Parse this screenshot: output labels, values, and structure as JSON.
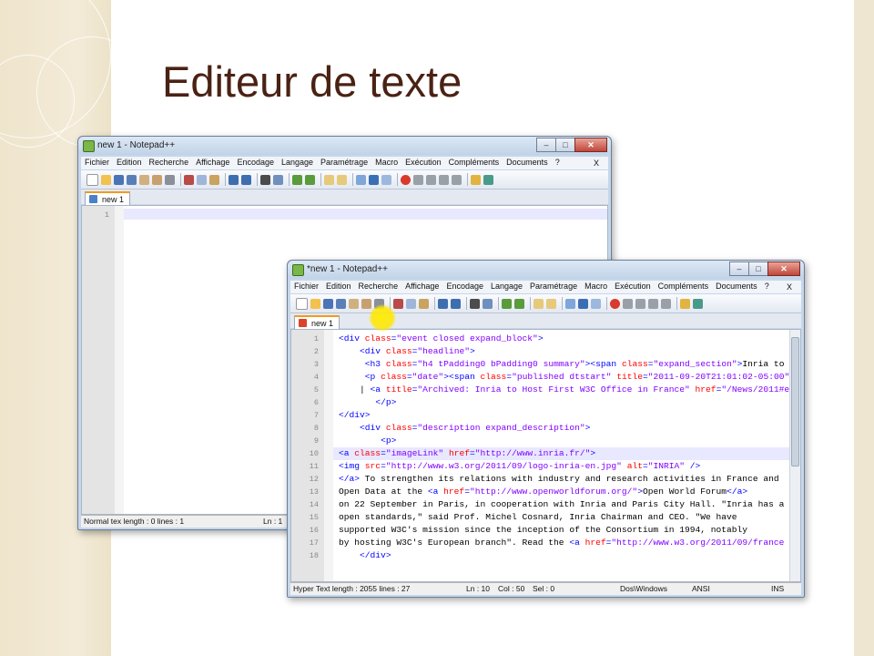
{
  "slide": {
    "title": "Editeur de texte"
  },
  "window_back": {
    "title": "new  1 - Notepad++",
    "menu": [
      "Fichier",
      "Edition",
      "Recherche",
      "Affichage",
      "Encodage",
      "Langage",
      "Paramétrage",
      "Macro",
      "Exécution",
      "Compléments",
      "Documents",
      "?"
    ],
    "menu_close": "X",
    "tab": "new  1",
    "line_numbers": [
      "1"
    ],
    "status": {
      "left": "Normal tex length : 0   lines : 1",
      "pos": "Ln : 1"
    }
  },
  "window_front": {
    "title": "*new  1 - Notepad++",
    "menu": [
      "Fichier",
      "Edition",
      "Recherche",
      "Affichage",
      "Encodage",
      "Langage",
      "Paramétrage",
      "Macro",
      "Exécution",
      "Compléments",
      "Documents",
      "?"
    ],
    "menu_close": "X",
    "tab": "new  1",
    "lines": [
      {
        "n": "1",
        "t": "<div class=\"event closed expand_block\">"
      },
      {
        "n": "2",
        "t": "    <div class=\"headline\">"
      },
      {
        "n": "3",
        "t": "     <h3 class=\"h4 tPadding0 bPadding0 summary\"><span class=\"expand_section\">Inria to"
      },
      {
        "n": "4",
        "t": "     <p class=\"date\"><span class=\"published dtstart\" title=\"2011-09-20T21:01:02-05:00\""
      },
      {
        "n": "5",
        "t": "    | <a title=\"Archived: Inria to Host First W3C Office in France\" href=\"/News/2011#en"
      },
      {
        "n": "6",
        "t": "       </p>"
      },
      {
        "n": "7",
        "t": "</div>"
      },
      {
        "n": "8",
        "t": "    <div class=\"description expand_description\">"
      },
      {
        "n": "9",
        "t": "        <p>"
      },
      {
        "n": "10",
        "t": "<a class=\"imageLink\" href=\"http://www.inria.fr/\">"
      },
      {
        "n": "11",
        "t": "<img src=\"http://www.w3.org/2011/09/logo-inria-en.jpg\" alt=\"INRIA\" />"
      },
      {
        "n": "12",
        "t": "</a> To strengthen its relations with industry and research activities in France and"
      },
      {
        "n": "13",
        "t": "Open Data at the <a href=\"http://www.openworldforum.org/\">Open World Forum</a>"
      },
      {
        "n": "14",
        "t": "on 22 September in Paris, in cooperation with Inria and Paris City Hall. \"Inria has a"
      },
      {
        "n": "15",
        "t": "open standards,\" said Prof. Michel Cosnard, Inria Chairman and CEO. \"We have"
      },
      {
        "n": "16",
        "t": "supported W3C's mission since the inception of the Consortium in 1994, notably"
      },
      {
        "n": "17",
        "t": "by hosting W3C's European branch\". Read the <a href=\"http://www.w3.org/2011/09/france"
      },
      {
        "n": "18",
        "t": "    </div>"
      }
    ],
    "status": {
      "length": "Hyper Text length : 2055    lines : 27",
      "ln": "Ln : 10",
      "col": "Col : 50",
      "sel": "Sel : 0",
      "eol": "Dos\\Windows",
      "enc": "ANSI",
      "ins": "INS"
    }
  },
  "colors": {
    "tag": "#0000ff",
    "attr": "#ff0000",
    "value": "#8000ff",
    "title": "#4a2214",
    "tab_accent": "#f29b1d"
  }
}
